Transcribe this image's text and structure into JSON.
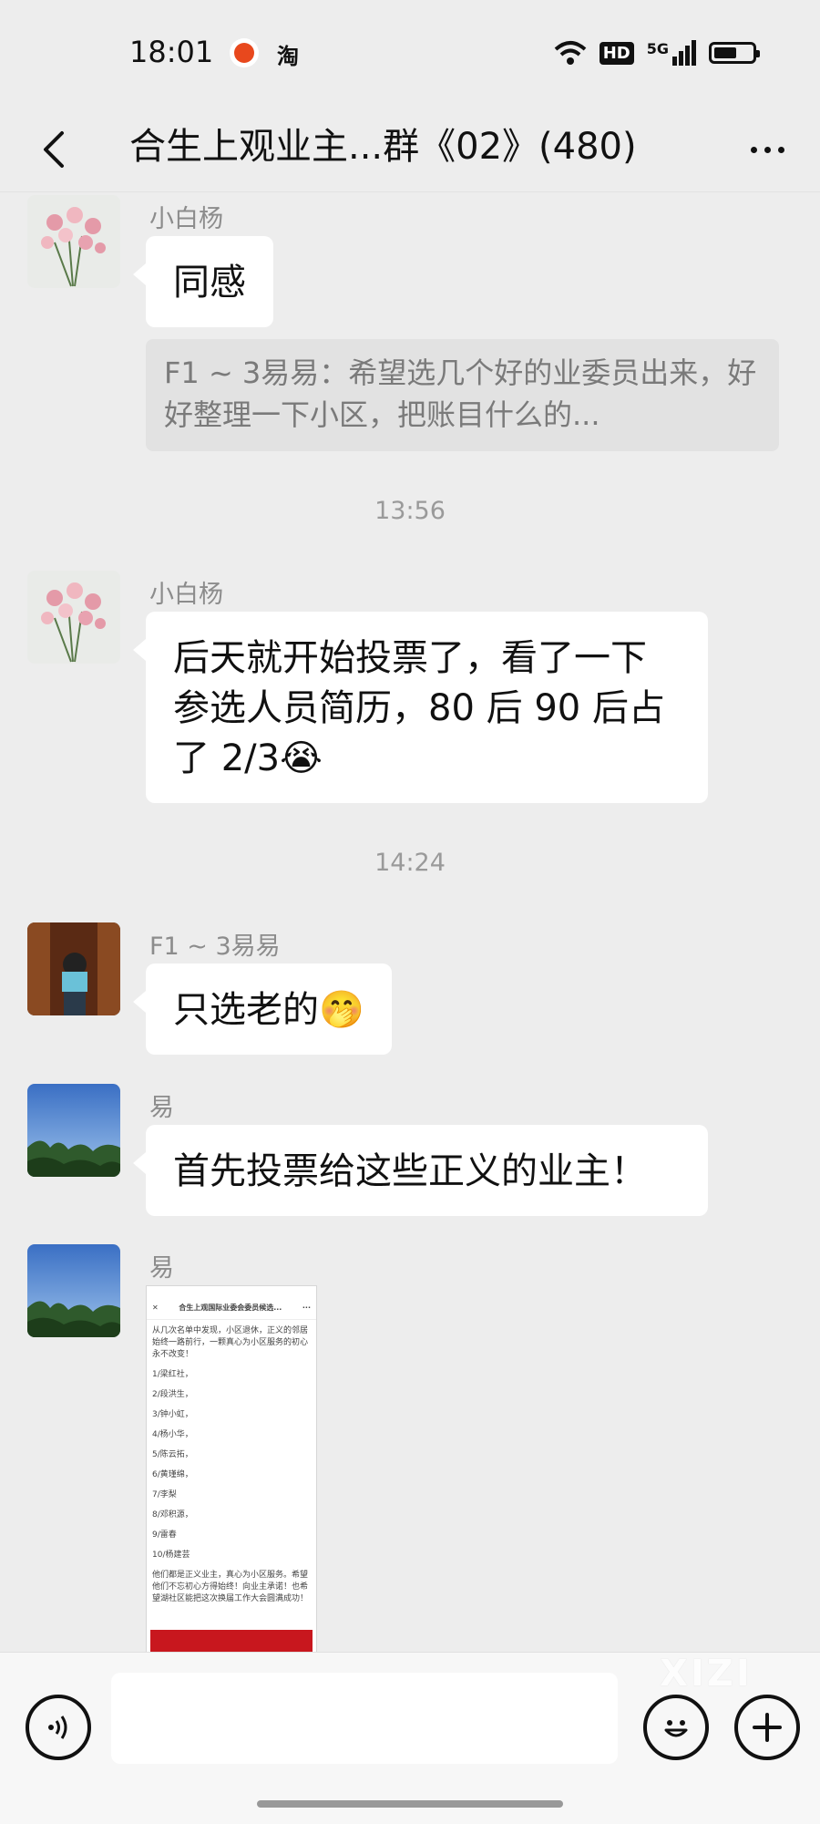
{
  "status_bar": {
    "time": "18:01",
    "app_icon": "淘",
    "hd": "HD",
    "network": "5G",
    "icons": [
      "wifi-icon",
      "signal-icon",
      "battery-icon"
    ],
    "battery_level": 0.6
  },
  "header": {
    "title": "合生上观业主...群《02》(480)"
  },
  "messages": [
    {
      "sender": "小白杨",
      "text": "同感",
      "quote": "F1 ~ 3易易：希望选几个好的业委员出来，好好整理一下小区，把账目什么的..."
    },
    {
      "timestamp": "13:56"
    },
    {
      "sender": "小白杨",
      "text": "后天就开始投票了，看了一下参选人员简历，80 后 90 后占了 2/3😭"
    },
    {
      "timestamp": "14:24"
    },
    {
      "sender": "F1 ~ 3易易",
      "text": "只选老的🤭"
    },
    {
      "sender": "易",
      "text": "首先投票给这些正义的业主！"
    },
    {
      "sender": "易",
      "image": {
        "title": "合生上观国际业委会委员候选...",
        "intro": "从几次名单中发现，小区退休，正义的邻居始终一路前行，一颗真心为小区服务的初心永不改变！",
        "names": [
          "1/梁红社，",
          "2/段洪生，",
          "3/钟小虹，",
          "4/杨小华，",
          "5/陈云拓，",
          "6/黄瑾绵，",
          "7/李梨",
          "8/邓积源，",
          "9/雷春",
          "10/杨建芸"
        ],
        "outro": "他们都是正义业主，真心为小区服务。希望他们不忘初心方得始终！向业主承诺！也希望湖社区能把这次换届工作大会圆满成功！"
      }
    }
  ],
  "input_bar": {
    "placeholder": "",
    "watermark": "XIZI"
  },
  "colors": {
    "background": "#ededed",
    "bubble": "#ffffff",
    "quote": "#e2e2e2"
  }
}
